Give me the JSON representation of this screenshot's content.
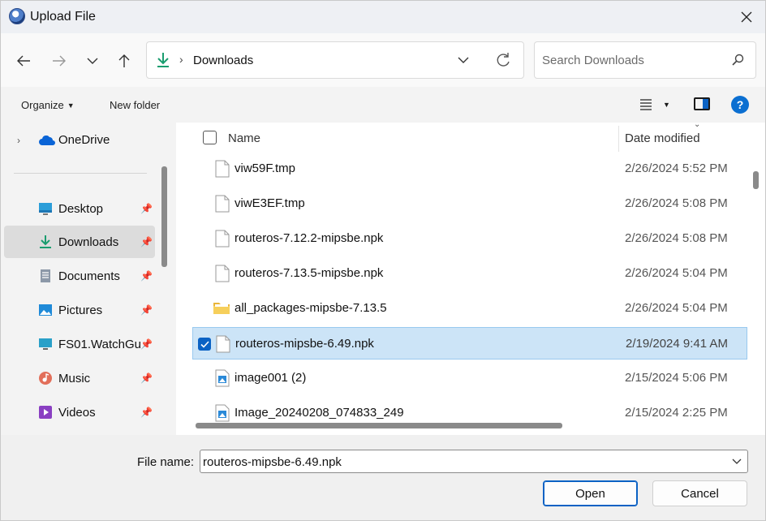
{
  "window": {
    "title": "Upload File"
  },
  "nav": {
    "address": "Downloads",
    "search_placeholder": "Search Downloads"
  },
  "commands": {
    "organize": "Organize",
    "new_folder": "New folder"
  },
  "sidebar": {
    "onedrive": "OneDrive",
    "items": [
      {
        "label": "Desktop",
        "icon": "desktop-icon"
      },
      {
        "label": "Downloads",
        "icon": "download-icon",
        "selected": true
      },
      {
        "label": "Documents",
        "icon": "documents-icon"
      },
      {
        "label": "Pictures",
        "icon": "pictures-icon"
      },
      {
        "label": "FS01.WatchGu",
        "icon": "network-drive-icon"
      },
      {
        "label": "Music",
        "icon": "music-icon"
      },
      {
        "label": "Videos",
        "icon": "videos-icon"
      }
    ]
  },
  "columns": {
    "name": "Name",
    "date": "Date modified"
  },
  "files": [
    {
      "name": "viw59F.tmp",
      "date": "2/26/2024 5:52 PM",
      "type": "file"
    },
    {
      "name": "viwE3EF.tmp",
      "date": "2/26/2024 5:08 PM",
      "type": "file"
    },
    {
      "name": "routeros-7.12.2-mipsbe.npk",
      "date": "2/26/2024 5:08 PM",
      "type": "file"
    },
    {
      "name": "routeros-7.13.5-mipsbe.npk",
      "date": "2/26/2024 5:04 PM",
      "type": "file"
    },
    {
      "name": "all_packages-mipsbe-7.13.5",
      "date": "2/26/2024 5:04 PM",
      "type": "folder"
    },
    {
      "name": "routeros-mipsbe-6.49.npk",
      "date": "2/19/2024 9:41 AM",
      "type": "file",
      "selected": true
    },
    {
      "name": "image001 (2)",
      "date": "2/15/2024 5:06 PM",
      "type": "image"
    },
    {
      "name": "Image_20240208_074833_249",
      "date": "2/15/2024 2:25 PM",
      "type": "image"
    }
  ],
  "footer": {
    "file_name_label": "File name:",
    "file_name_value": "routeros-mipsbe-6.49.npk",
    "open_label": "Open",
    "cancel_label": "Cancel"
  }
}
